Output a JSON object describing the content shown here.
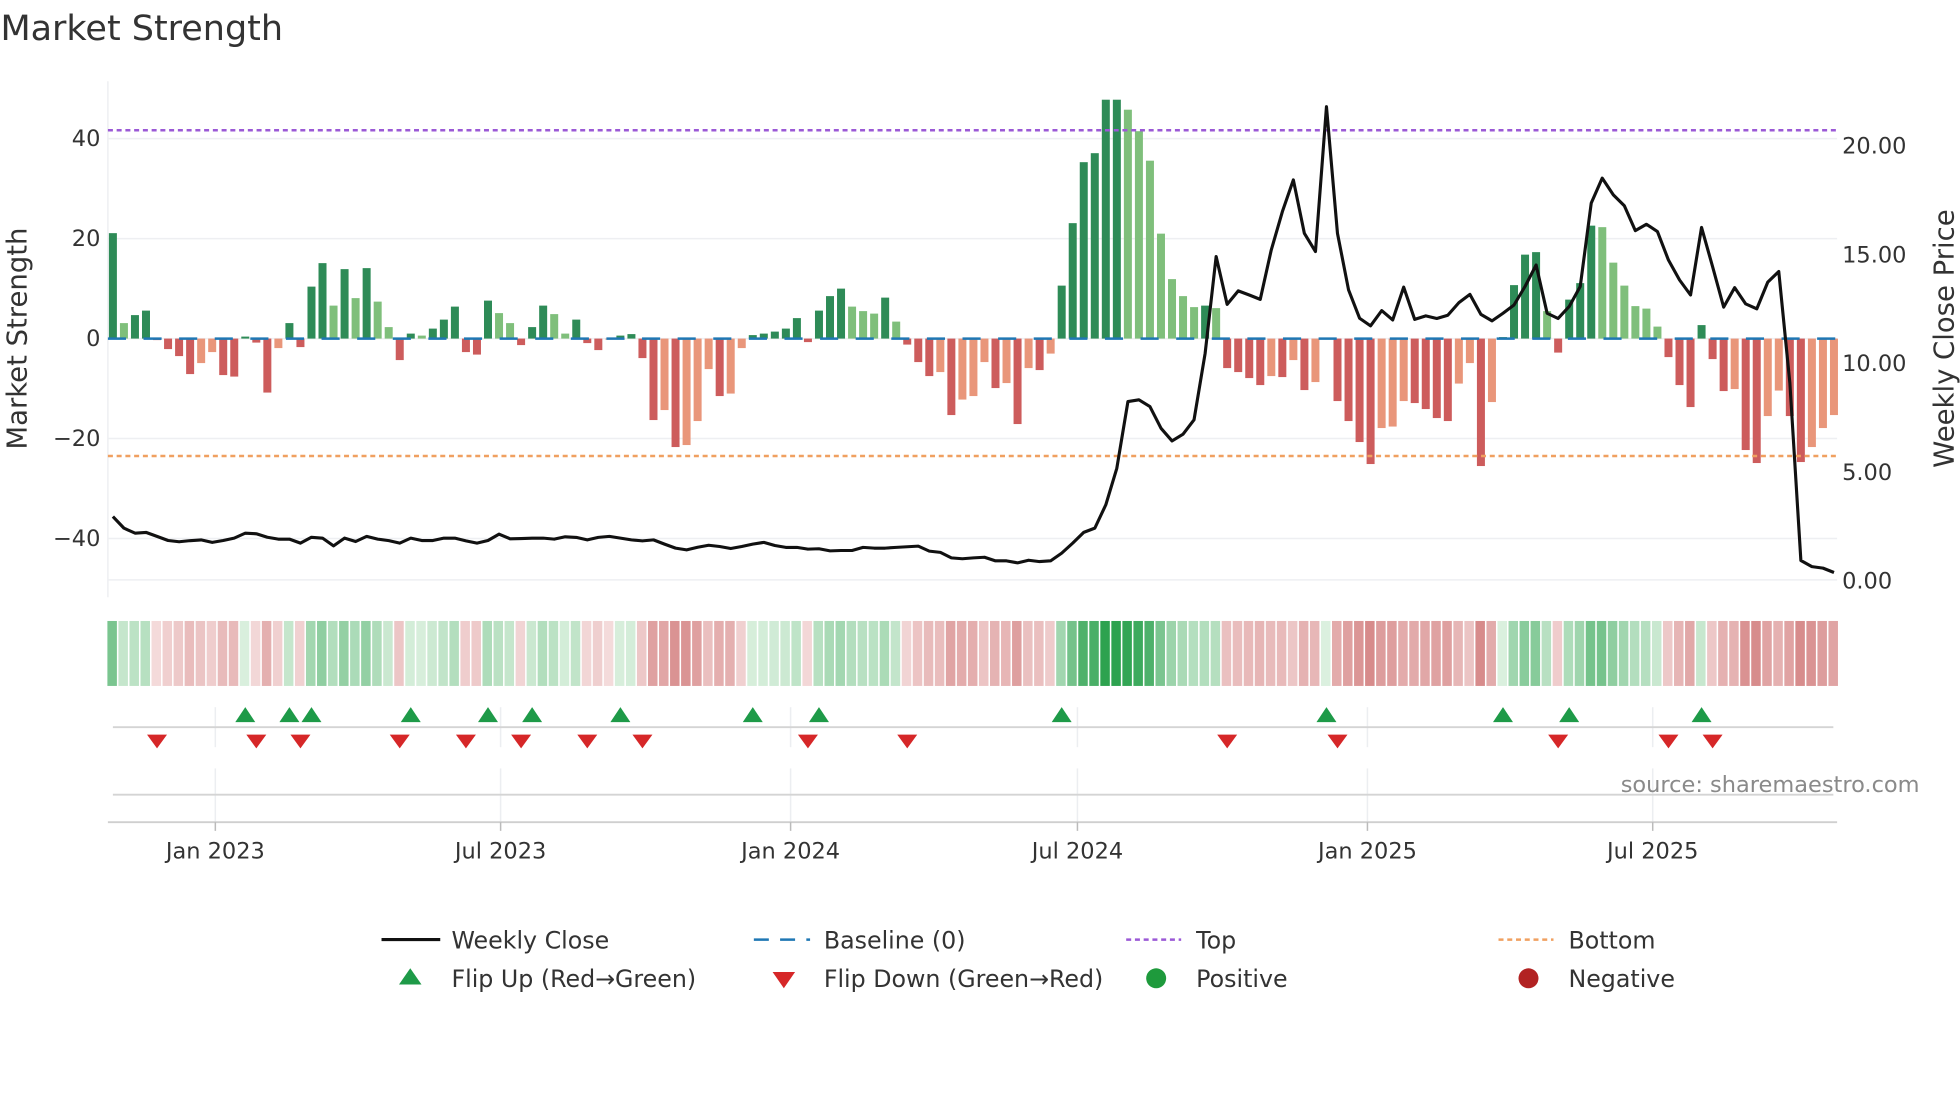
{
  "chart_data": {
    "type": "bar",
    "title": "Market Strength",
    "ylabel": "Market Strength",
    "ylabel_right": "Weekly Close Price",
    "ylim": [
      -51.75,
      51.5
    ],
    "ylim_right": [
      -0.8,
      22.93
    ],
    "yticks": [
      {
        "value": 40,
        "label": "40"
      },
      {
        "value": 20,
        "label": "20"
      },
      {
        "value": 0,
        "label": "0"
      },
      {
        "value": -20,
        "label": "−20"
      },
      {
        "value": -40,
        "label": "−40"
      }
    ],
    "yticks_right": [
      {
        "value": 20,
        "label": "20.00"
      },
      {
        "value": 15,
        "label": "15.00"
      },
      {
        "value": 10,
        "label": "10.00"
      },
      {
        "value": 5,
        "label": "5.00"
      },
      {
        "value": 0,
        "label": "0.00"
      }
    ],
    "xticks": [
      {
        "date": "2023-01-01",
        "label": "Jan 2023"
      },
      {
        "date": "2023-07-01",
        "label": "Jul 2023"
      },
      {
        "date": "2024-01-01",
        "label": "Jan 2024"
      },
      {
        "date": "2024-07-01",
        "label": "Jul 2024"
      },
      {
        "date": "2025-01-01",
        "label": "Jan 2025"
      },
      {
        "date": "2025-07-01",
        "label": "Jul 2025"
      }
    ],
    "start_date": "2022-10-28",
    "frequency": "weekly",
    "top_level": 41.7,
    "bottom_level": -23.5,
    "baseline": 0,
    "grid": true,
    "legend_position": "bottom",
    "strength": [
      21.1,
      3.1,
      4.7,
      5.6,
      -0.3,
      -2.1,
      -3.5,
      -7.1,
      -4.9,
      -2.7,
      -7.3,
      -7.6,
      0.4,
      -0.8,
      -10.8,
      -1.9,
      3.1,
      -1.7,
      10.4,
      15.1,
      6.6,
      13.9,
      8.1,
      14.1,
      7.4,
      2.3,
      -4.3,
      1.0,
      0.6,
      2.0,
      3.8,
      6.4,
      -2.7,
      -3.2,
      7.6,
      5.1,
      3.1,
      -1.3,
      2.3,
      6.6,
      4.9,
      1.0,
      3.8,
      -0.9,
      -2.3,
      -0.2,
      0.6,
      0.9,
      -3.9,
      -16.3,
      -14.3,
      -21.7,
      -21.3,
      -16.5,
      -6.1,
      -11.5,
      -11.0,
      -1.9,
      0.7,
      1.0,
      1.4,
      2.0,
      4.1,
      -0.7,
      5.6,
      8.5,
      10.0,
      6.4,
      5.5,
      5.0,
      8.2,
      3.4,
      -1.2,
      -4.7,
      -7.5,
      -6.7,
      -15.3,
      -12.2,
      -11.5,
      -4.7,
      -9.9,
      -8.9,
      -17.1,
      -5.9,
      -6.3,
      -3.0,
      10.6,
      23.1,
      35.3,
      37.1,
      47.8,
      47.8,
      45.8,
      41.5,
      35.6,
      21.0,
      11.9,
      8.5,
      6.3,
      6.6,
      6.1,
      -5.9,
      -6.7,
      -7.9,
      -9.3,
      -7.5,
      -7.7,
      -4.3,
      -10.3,
      -8.7,
      0.2,
      -12.5,
      -16.5,
      -20.7,
      -25.1,
      -17.9,
      -17.6,
      -12.5,
      -12.9,
      -14.1,
      -15.9,
      -16.5,
      -9.0,
      -4.9,
      -25.5,
      -12.7,
      0.3,
      10.7,
      16.8,
      17.3,
      5.5,
      -2.8,
      7.8,
      11.1,
      22.6,
      22.3,
      15.2,
      10.6,
      6.5,
      6.0,
      2.4,
      -3.7,
      -9.3,
      -13.7,
      2.7,
      -4.1,
      -10.5,
      -10.1,
      -22.3,
      -24.9,
      -15.5,
      -10.4,
      -15.5,
      -24.7,
      -21.7,
      -17.9,
      -15.3
    ],
    "close": [
      2.91,
      2.38,
      2.15,
      2.18,
      2.0,
      1.81,
      1.75,
      1.8,
      1.84,
      1.72,
      1.81,
      1.92,
      2.15,
      2.12,
      1.96,
      1.87,
      1.87,
      1.69,
      1.96,
      1.92,
      1.56,
      1.92,
      1.76,
      2.0,
      1.87,
      1.8,
      1.69,
      1.92,
      1.81,
      1.81,
      1.92,
      1.92,
      1.79,
      1.69,
      1.81,
      2.1,
      1.89,
      1.9,
      1.92,
      1.92,
      1.87,
      1.98,
      1.95,
      1.84,
      1.95,
      2.0,
      1.92,
      1.84,
      1.79,
      1.84,
      1.64,
      1.46,
      1.38,
      1.5,
      1.59,
      1.53,
      1.44,
      1.53,
      1.64,
      1.72,
      1.58,
      1.49,
      1.49,
      1.41,
      1.43,
      1.33,
      1.35,
      1.35,
      1.49,
      1.46,
      1.46,
      1.49,
      1.52,
      1.55,
      1.32,
      1.26,
      1.01,
      0.97,
      1.01,
      1.04,
      0.87,
      0.87,
      0.78,
      0.9,
      0.84,
      0.87,
      1.23,
      1.69,
      2.18,
      2.38,
      3.45,
      5.13,
      8.2,
      8.28,
      7.97,
      6.97,
      6.39,
      6.7,
      7.36,
      10.42,
      14.87,
      12.67,
      13.29,
      13.1,
      12.9,
      15.17,
      16.93,
      18.39,
      15.94,
      15.1,
      21.76,
      15.94,
      13.33,
      12.03,
      11.68,
      12.38,
      11.95,
      13.46,
      11.98,
      12.14,
      12.02,
      12.17,
      12.75,
      13.13,
      12.21,
      11.91,
      12.26,
      12.64,
      13.49,
      14.48,
      12.26,
      12.02,
      12.57,
      13.49,
      17.32,
      18.47,
      17.7,
      17.2,
      16.06,
      16.35,
      16.02,
      14.71,
      13.79,
      13.1,
      16.21,
      14.41,
      12.54,
      13.44,
      12.69,
      12.46,
      13.69,
      14.18,
      9.04,
      0.89,
      0.61,
      0.54,
      0.34
    ],
    "legend": {
      "weekly_close": "Weekly Close",
      "baseline": "Baseline (0)",
      "top": "Top",
      "bottom": "Bottom",
      "flip_up": "Flip Up (Red→Green)",
      "flip_down": "Flip Down (Green→Red)",
      "positive": "Positive",
      "negative": "Negative"
    },
    "source": "source: sharemaestro.com"
  },
  "colors": {
    "pos_dark": "#2e8b57",
    "pos_light": "#7fbf7b",
    "neg_dark": "#cd5c5c",
    "neg_light": "#e9967a",
    "baseline": "#1f77b4",
    "top": "#9b59d6",
    "bottom": "#f0a060",
    "close": "#111111",
    "flip_up": "#1e9a48",
    "flip_down": "#d62728",
    "positive": "#1e9a3c",
    "negative": "#b22222"
  }
}
